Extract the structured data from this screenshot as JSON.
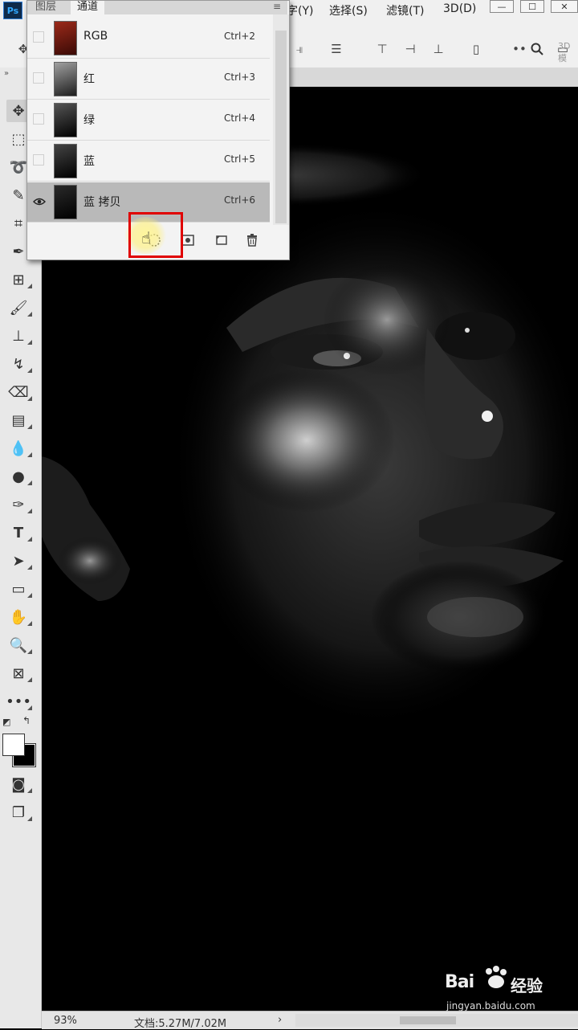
{
  "app": {
    "logo": "Ps"
  },
  "menubar": {
    "items": [
      "字(Y)",
      "选择(S)",
      "滤镜(T)",
      "3D(D)"
    ]
  },
  "optionsbar": {
    "label_3d": "3D 模"
  },
  "panel": {
    "tabs": [
      "图层",
      "通道"
    ],
    "active_tab": "通道",
    "channels": [
      {
        "name": "RGB",
        "shortcut": "Ctrl+2",
        "visible": false,
        "selected": false,
        "thumb_color": "#7a1f14"
      },
      {
        "name": "红",
        "shortcut": "Ctrl+3",
        "visible": false,
        "selected": false,
        "thumb_color": "#6a6a6a"
      },
      {
        "name": "绿",
        "shortcut": "Ctrl+4",
        "visible": false,
        "selected": false,
        "thumb_color": "#2a2a2a"
      },
      {
        "name": "蓝",
        "shortcut": "Ctrl+5",
        "visible": false,
        "selected": false,
        "thumb_color": "#1e1e1e"
      },
      {
        "name": "蓝 拷贝",
        "shortcut": "Ctrl+6",
        "visible": true,
        "selected": true,
        "thumb_color": "#0a0a0a"
      }
    ]
  },
  "statusbar": {
    "zoom": "93%",
    "doc_info": "文档:5.27M/7.02M",
    "arrow": "›"
  },
  "watermark": {
    "brand": "Bai",
    "brand_cn": "经验",
    "url": "jingyan.baidu.com"
  },
  "colors": {
    "highlight": "#e00000",
    "selected_row": "#b9b9b9",
    "ps_blue": "#31a8ff"
  }
}
